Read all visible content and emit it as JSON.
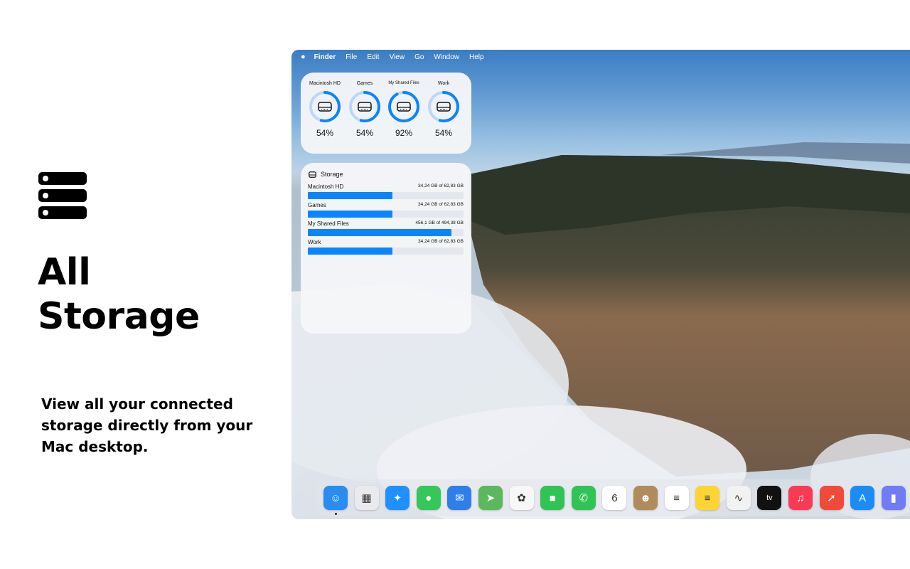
{
  "headline": {
    "line1": "All",
    "line2": "Storage"
  },
  "description": "View all your connected storage directly from your Mac desktop.",
  "menubar": {
    "apple": "",
    "items": [
      "Finder",
      "File",
      "Edit",
      "View",
      "Go",
      "Window",
      "Help"
    ]
  },
  "disks_widget": {
    "drives": [
      {
        "name": "Macintosh HD",
        "percent": "54%",
        "value": 0.54
      },
      {
        "name": "Games",
        "percent": "54%",
        "value": 0.54
      },
      {
        "name": "My Shared Files",
        "percent": "92%",
        "value": 0.92
      },
      {
        "name": "Work",
        "percent": "54%",
        "value": 0.54
      }
    ]
  },
  "storage_widget": {
    "title": "Storage",
    "rows": [
      {
        "name": "Macintosh HD",
        "size": "34,24 GB of 62,83 GB",
        "value": 0.545
      },
      {
        "name": "Games",
        "size": "34,24 GB of 62,83 GB",
        "value": 0.545
      },
      {
        "name": "My Shared Files",
        "size": "456,1 GB of 494,38 GB",
        "value": 0.923
      },
      {
        "name": "Work",
        "size": "34,24 GB of 62,83 GB",
        "value": 0.545
      }
    ]
  },
  "dock": {
    "apps": [
      {
        "icon": "finder-icon",
        "color": "#2a8cf0",
        "glyph": "☺",
        "running": true
      },
      {
        "icon": "launchpad-icon",
        "color": "#e9e9ee",
        "glyph": "▦"
      },
      {
        "icon": "safari-icon",
        "color": "#1e90ff",
        "glyph": "✦"
      },
      {
        "icon": "messages-icon",
        "color": "#34c759",
        "glyph": "●"
      },
      {
        "icon": "mail-icon",
        "color": "#2f7fe8",
        "glyph": "✉"
      },
      {
        "icon": "maps-icon",
        "color": "#5cb85c",
        "glyph": "➤"
      },
      {
        "icon": "photos-icon",
        "color": "#f7f7f7",
        "glyph": "✿"
      },
      {
        "icon": "facetime-icon",
        "color": "#30c454",
        "glyph": "■"
      },
      {
        "icon": "phone-icon",
        "color": "#30c454",
        "glyph": "✆"
      },
      {
        "icon": "calendar-icon",
        "color": "#ffffff",
        "glyph": "6"
      },
      {
        "icon": "contacts-icon",
        "color": "#b08b5b",
        "glyph": "☻"
      },
      {
        "icon": "reminders-icon",
        "color": "#ffffff",
        "glyph": "≡"
      },
      {
        "icon": "notes-icon",
        "color": "#fcd535",
        "glyph": "≡"
      },
      {
        "icon": "freeform-icon",
        "color": "#f2f2f2",
        "glyph": "∿"
      },
      {
        "icon": "apple-tv-icon",
        "color": "#111111",
        "glyph": "tv"
      },
      {
        "icon": "music-icon",
        "color": "#fa3a55",
        "glyph": "♫"
      },
      {
        "icon": "rocket-icon",
        "color": "#f04a3a",
        "glyph": "➚"
      },
      {
        "icon": "app-store-icon",
        "color": "#1b8cf5",
        "glyph": "A"
      },
      {
        "icon": "storage-app-icon",
        "color": "#6f7cf5",
        "glyph": "▮"
      }
    ]
  }
}
